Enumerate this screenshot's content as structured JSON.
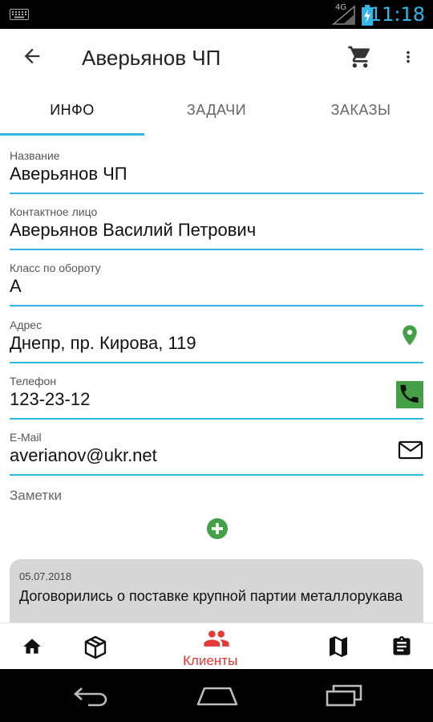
{
  "status_bar": {
    "time": "11:18",
    "network": "4G"
  },
  "app_bar": {
    "title": "Аверьянов ЧП",
    "icons": {
      "back": "arrow-back-icon",
      "cart": "cart-icon",
      "more": "more-vert-icon"
    }
  },
  "tabs": [
    {
      "label": "ИНФО",
      "active": true
    },
    {
      "label": "ЗАДАЧИ",
      "active": false
    },
    {
      "label": "ЗАКАЗЫ",
      "active": false
    }
  ],
  "fields": {
    "name": {
      "label": "Название",
      "value": "Аверьянов ЧП"
    },
    "contact": {
      "label": "Контактное лицо",
      "value": "Аверьянов Василий Петрович"
    },
    "class": {
      "label": "Класс по обороту",
      "value": "А"
    },
    "address": {
      "label": "Адрес",
      "value": "Днепр, пр. Кирова, 119",
      "icon": "location-pin-icon"
    },
    "phone": {
      "label": "Телефон",
      "value": "123-23-12",
      "icon": "phone-icon"
    },
    "email": {
      "label": "E-Mail",
      "value": "averianov@ukr.net",
      "icon": "mail-icon"
    }
  },
  "notes": {
    "label": "Заметки",
    "add_icon": "add-circle-icon",
    "items": [
      {
        "date": "05.07.2018",
        "text": "Договорились о поставке крупной партии металлорукава"
      }
    ]
  },
  "bottom_nav": {
    "items": [
      {
        "icon": "home-icon",
        "label": ""
      },
      {
        "icon": "package-icon",
        "label": ""
      },
      {
        "icon": "people-icon",
        "label": "Клиенты",
        "active": true
      },
      {
        "icon": "map-icon",
        "label": ""
      },
      {
        "icon": "clipboard-icon",
        "label": ""
      }
    ]
  },
  "colors": {
    "accent": "#33b5e5",
    "active_nav": "#e53935",
    "green": "#43a047",
    "note_bg": "#d6d6d6"
  }
}
